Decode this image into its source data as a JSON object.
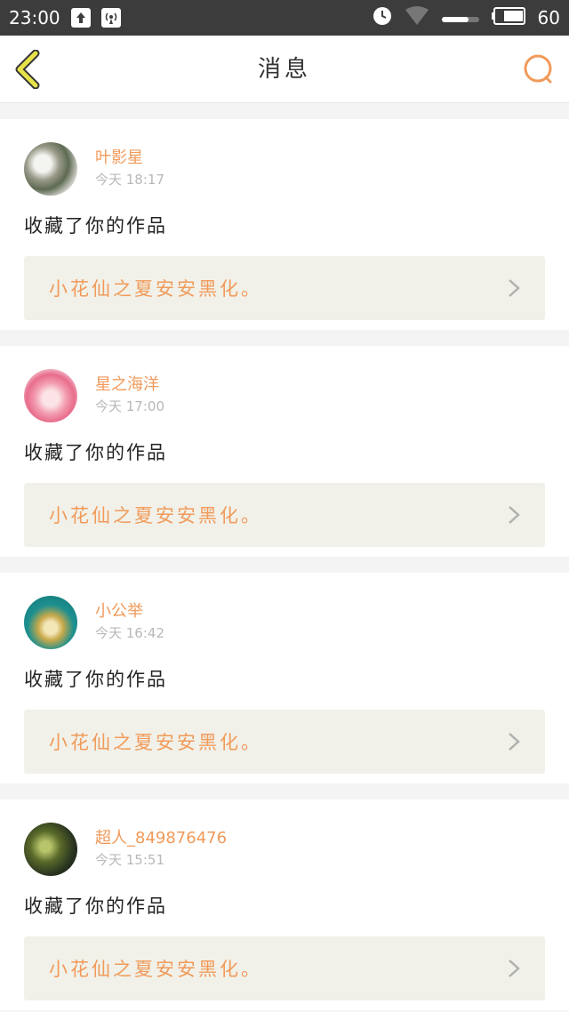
{
  "status_bar": {
    "time": "23:00",
    "battery": "60",
    "icons": [
      "upload-icon",
      "signal-icon",
      "alarm-icon",
      "wifi-icon",
      "battery-icon"
    ]
  },
  "header": {
    "title": "消息",
    "back_icon": "chevron-left-icon",
    "search_icon": "search-icon",
    "accent_color": "#f19a5a",
    "back_color": "#e8e24a"
  },
  "messages": [
    {
      "username": "叶影星",
      "time": "今天  18:17",
      "action": "收藏了你的作品",
      "work_title": "小花仙之夏安安黑化。"
    },
    {
      "username": "星之海洋",
      "time": "今天  17:00",
      "action": "收藏了你的作品",
      "work_title": "小花仙之夏安安黑化。"
    },
    {
      "username": "小公举",
      "time": "今天  16:42",
      "action": "收藏了你的作品",
      "work_title": "小花仙之夏安安黑化。"
    },
    {
      "username": "超人_849876476",
      "time": "今天  15:51",
      "action": "收藏了你的作品",
      "work_title": "小花仙之夏安安黑化。"
    }
  ]
}
